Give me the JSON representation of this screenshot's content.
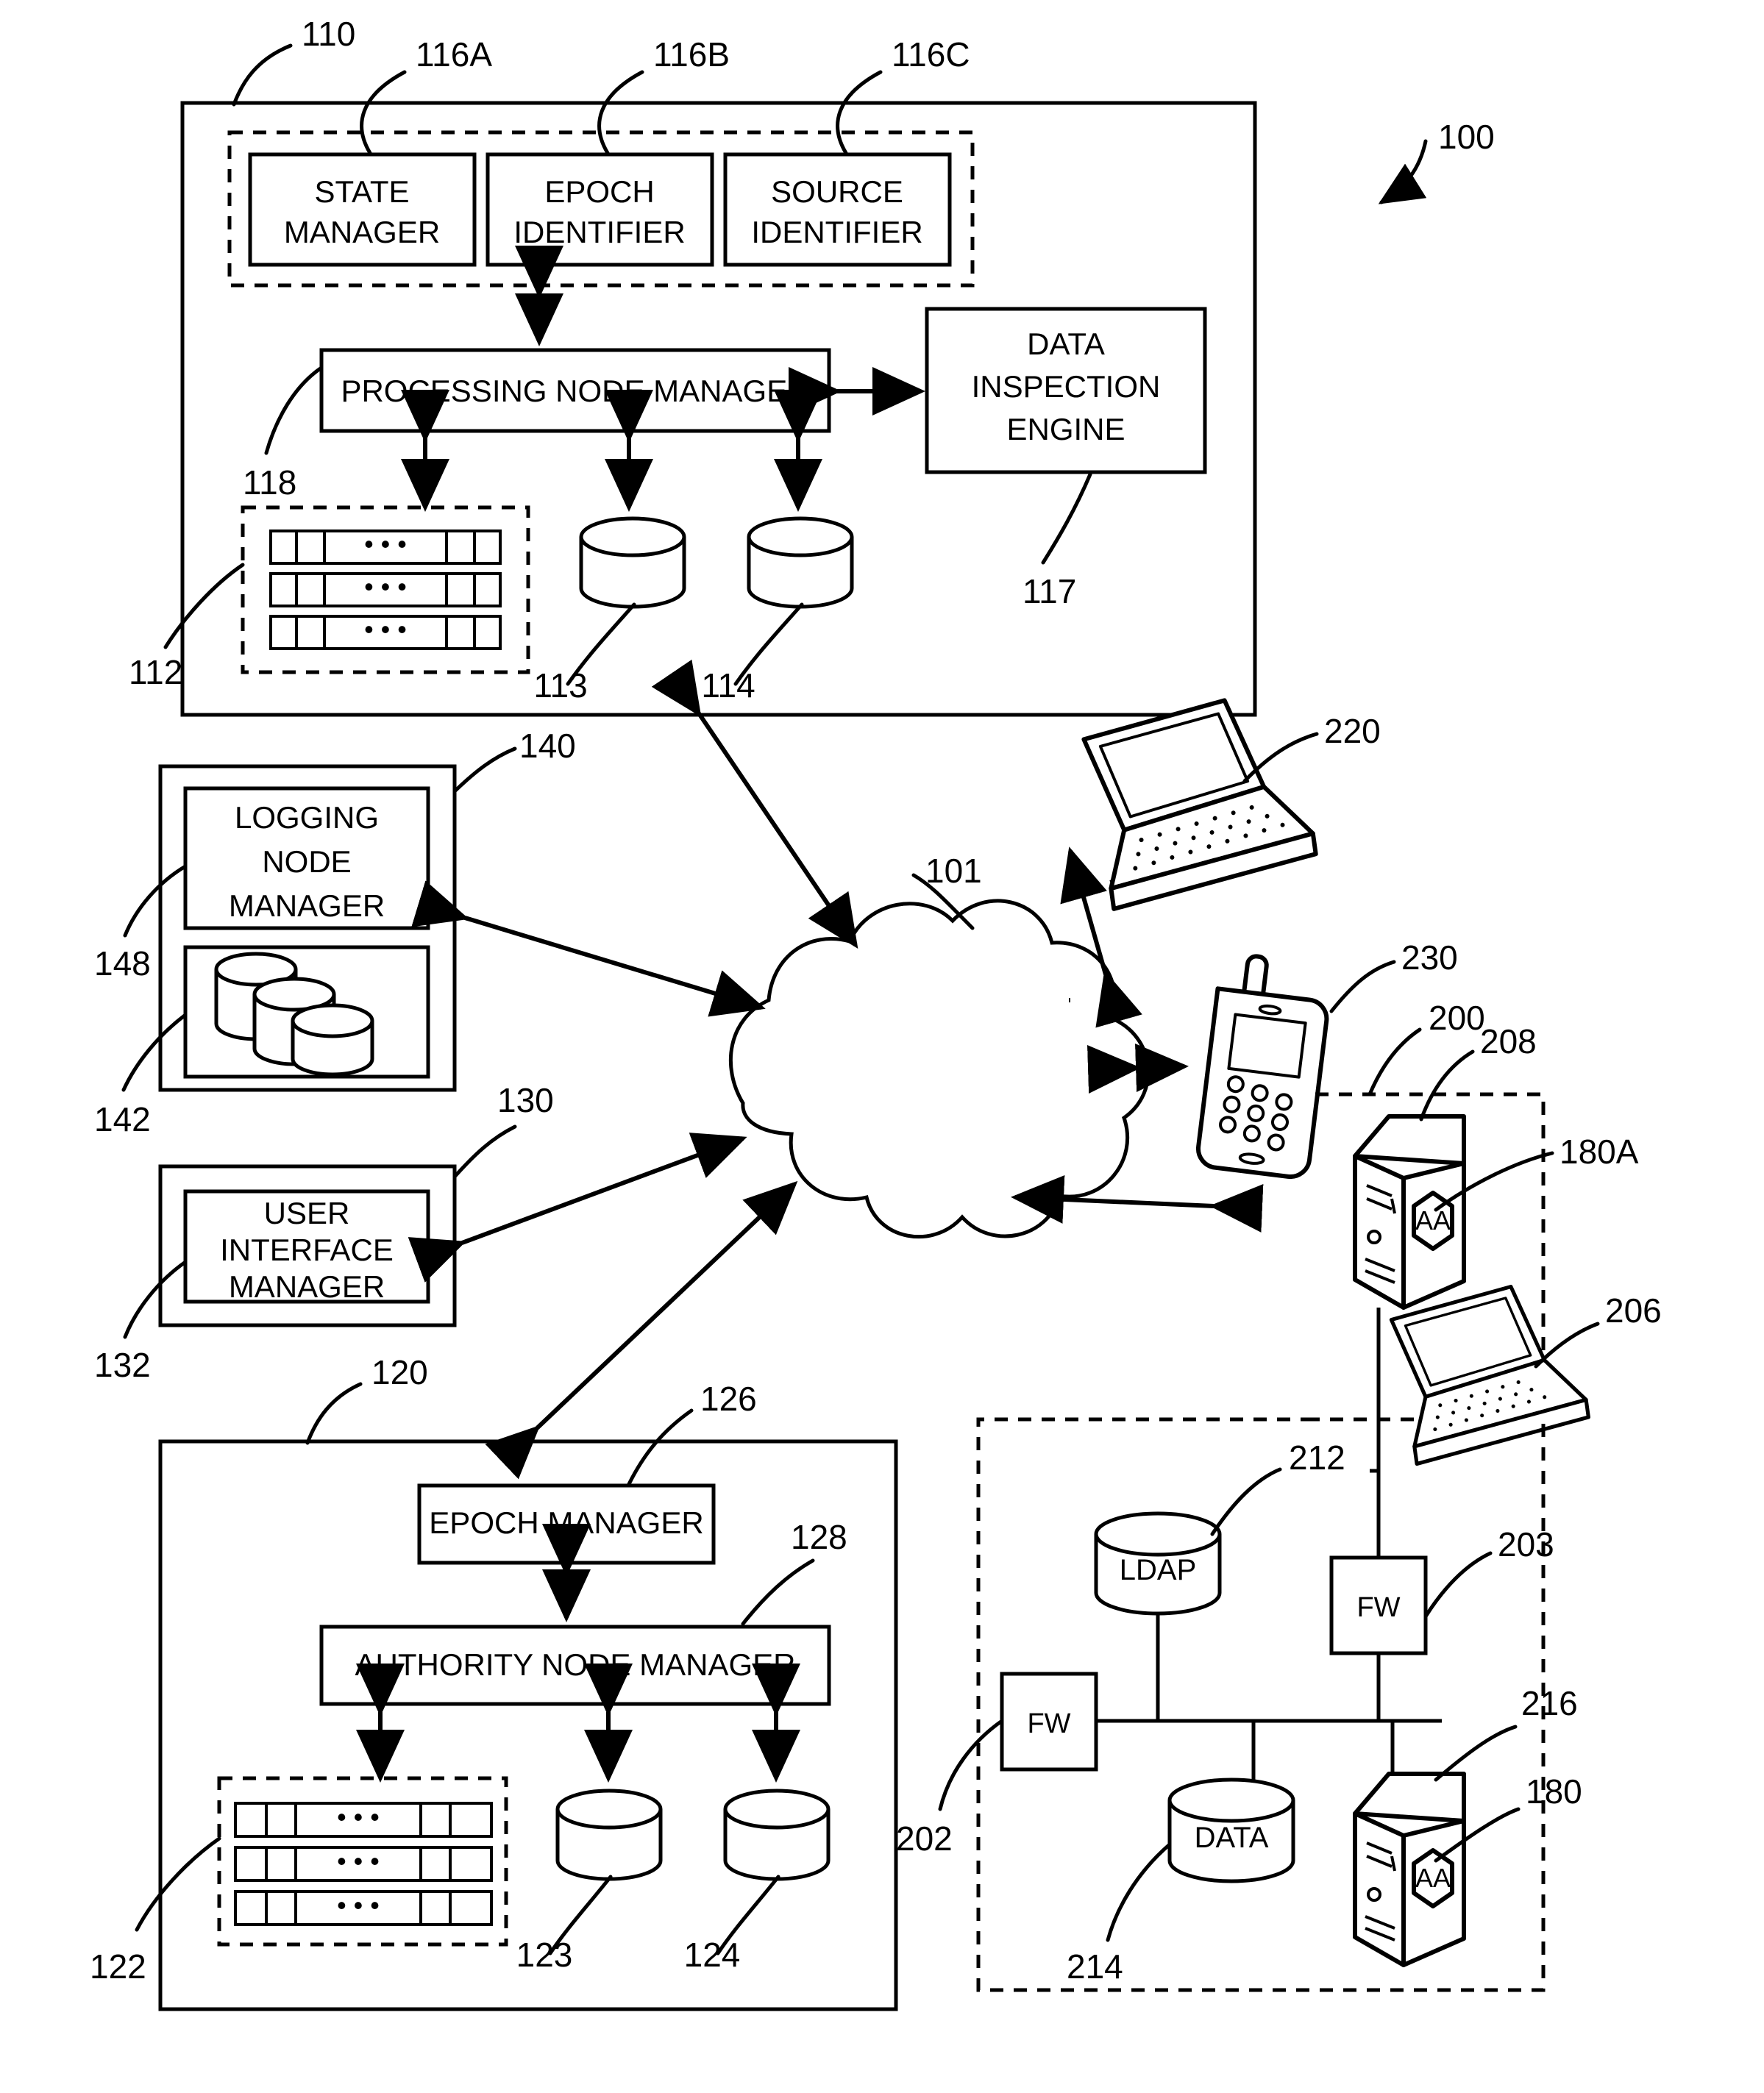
{
  "figure": {
    "type": "patent-system-diagram",
    "system_ref": "100",
    "network_ref": "101"
  },
  "processing_node": {
    "ref": "110",
    "manager": {
      "ref": "118",
      "label": "PROCESSING NODE MANAGER"
    },
    "modules_group_refs": [
      "116A",
      "116B",
      "116C"
    ],
    "modules": [
      {
        "ref": "116A",
        "label_line1": "STATE",
        "label_line2": "MANAGER"
      },
      {
        "ref": "116B",
        "label_line1": "EPOCH",
        "label_line2": "IDENTIFIER"
      },
      {
        "ref": "116C",
        "label_line1": "SOURCE",
        "label_line2": "IDENTIFIER"
      }
    ],
    "inspection_engine": {
      "ref": "117",
      "label_line1": "DATA",
      "label_line2": "INSPECTION",
      "label_line3": "ENGINE"
    },
    "rack": {
      "ref": "112",
      "rows": 3,
      "dots": "• • •"
    },
    "stores": [
      {
        "ref": "113"
      },
      {
        "ref": "114"
      }
    ]
  },
  "logging_node": {
    "ref": "140",
    "manager": {
      "ref": "148",
      "label_line1": "LOGGING",
      "label_line2": "NODE",
      "label_line3": "MANAGER"
    },
    "storage": {
      "ref": "142"
    }
  },
  "ui_node": {
    "ref": "130",
    "manager": {
      "ref": "132",
      "label_line1": "USER",
      "label_line2": "INTERFACE",
      "label_line3": "MANAGER"
    }
  },
  "authority_node": {
    "ref": "120",
    "epoch_manager": {
      "ref": "126",
      "label": "EPOCH MANAGER"
    },
    "manager": {
      "ref": "128",
      "label": "AUTHORITY NODE MANAGER"
    },
    "rack": {
      "ref": "122",
      "rows": 3,
      "dots": "• • •"
    },
    "stores": [
      {
        "ref": "123"
      },
      {
        "ref": "124"
      }
    ]
  },
  "clients": [
    {
      "ref": "220",
      "kind": "laptop"
    },
    {
      "ref": "230",
      "kind": "mobile-phone"
    }
  ],
  "enterprise": {
    "outer_ref": "200",
    "inner_ref": "202",
    "server_top": {
      "ref": "208",
      "badge": "AA",
      "badge_ref": "180A"
    },
    "laptop": {
      "ref": "206"
    },
    "firewall_right": {
      "ref": "203",
      "label": "FW"
    },
    "firewall_left": {
      "ref": "202",
      "label": "FW"
    },
    "ldap": {
      "ref": "212",
      "label": "LDAP"
    },
    "data": {
      "ref": "214",
      "label": "DATA"
    },
    "server_bottom": {
      "ref": "216",
      "badge": "AA",
      "badge_ref": "180"
    }
  },
  "reference_numerals": [
    "100",
    "101",
    "110",
    "112",
    "113",
    "114",
    "116A",
    "116B",
    "116C",
    "117",
    "118",
    "120",
    "122",
    "123",
    "124",
    "126",
    "128",
    "130",
    "132",
    "140",
    "142",
    "148",
    "180",
    "180A",
    "200",
    "202",
    "203",
    "206",
    "208",
    "212",
    "214",
    "216",
    "220",
    "230"
  ]
}
